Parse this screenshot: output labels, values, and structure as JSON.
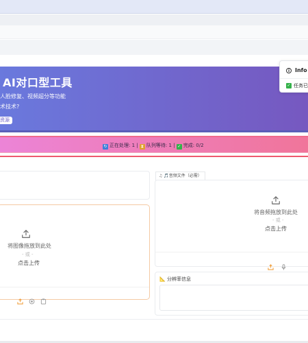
{
  "hero": {
    "title": "AI对口型工具",
    "subtitle_line1": "人脸修复、视频超分等功能",
    "subtitle_line2": "术技术?",
    "button_label": "资源"
  },
  "notification": {
    "title": "Info",
    "message": "任务已"
  },
  "status_bar": {
    "processing": "正在处理: 1",
    "queue": "队列等待: 1",
    "complete": "完成: 0/2",
    "separator": " | "
  },
  "image_upload": {
    "drop_text": "将图像拖放到此处",
    "or_text": "- 或 -",
    "click_text": "点击上传"
  },
  "audio_upload": {
    "tab_label": "音频文件（必需）",
    "drop_text": "将音频拖放到此处",
    "or_text": "- 或 -",
    "click_text": "点击上传"
  },
  "resolution": {
    "label": "分辨率信息"
  },
  "colors": {
    "hero_start": "#6a79dd",
    "hero_end": "#7658c0",
    "status_start": "#ec84d7",
    "status_end": "#f0759a",
    "accent_orange": "#f0a040",
    "success_green": "#35b24a"
  }
}
